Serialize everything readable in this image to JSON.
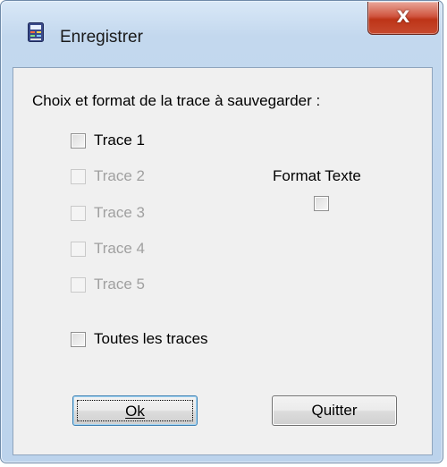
{
  "window": {
    "title": "Enregistrer",
    "close_glyph": "X",
    "icon": "app-icon"
  },
  "dialog": {
    "prompt": "Choix et format de la trace à sauvegarder :",
    "traces": [
      {
        "label": "Trace 1",
        "enabled": true,
        "checked": false
      },
      {
        "label": "Trace 2",
        "enabled": false,
        "checked": false
      },
      {
        "label": "Trace 3",
        "enabled": false,
        "checked": false
      },
      {
        "label": "Trace 4",
        "enabled": false,
        "checked": false
      },
      {
        "label": "Trace 5",
        "enabled": false,
        "checked": false
      }
    ],
    "all_traces": {
      "label": "Toutes les traces",
      "checked": false
    },
    "format_text": {
      "label": "Format Texte",
      "checked": false
    }
  },
  "buttons": {
    "ok": "Ok",
    "quit": "Quitter"
  },
  "colors": {
    "frame": "#c3d8ee",
    "close": "#c74a2f",
    "disabled_text": "#a0a0a0"
  }
}
